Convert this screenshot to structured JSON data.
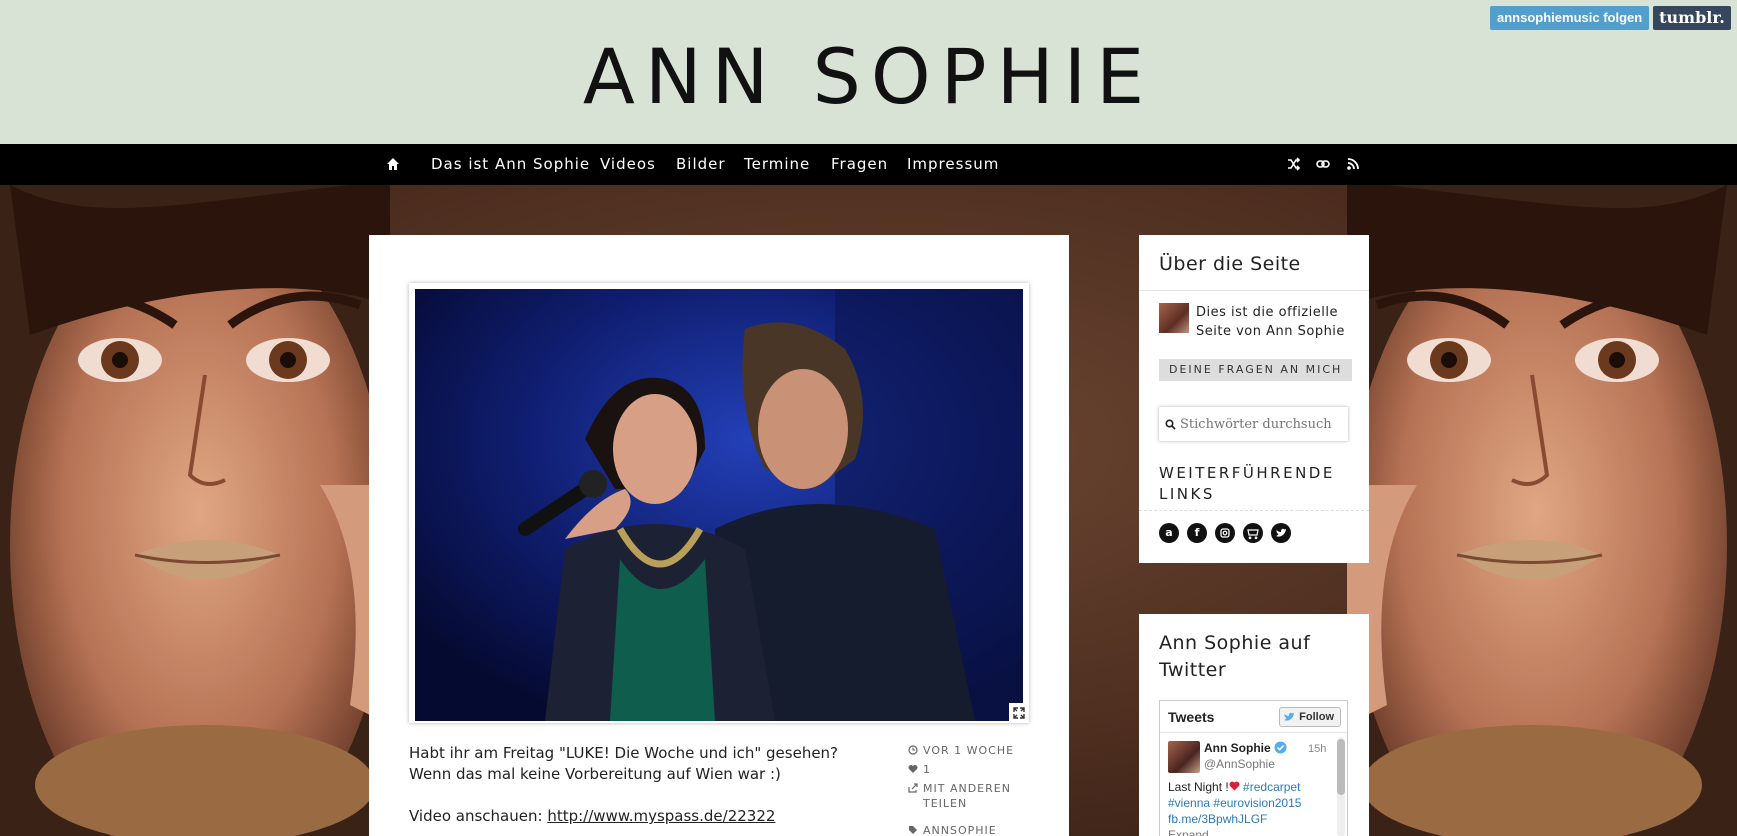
{
  "header": {
    "logo": "ANN SOPHIE",
    "tumblr_follow": "annsophiemusic folgen",
    "tumblr_logo": "tumblr."
  },
  "nav": {
    "items": [
      "Das ist Ann Sophie",
      "Videos",
      "Bilder",
      "Termine",
      "Fragen",
      "Impressum"
    ],
    "icons": [
      "home-icon",
      "shuffle-icon",
      "link-icon",
      "rss-icon"
    ]
  },
  "post": {
    "paragraph1": "Habt ihr am Freitag \"LUKE! Die Woche und ich\" gesehen? Wenn das mal keine Vorbereitung auf Wien war :)",
    "video_label": "Video anschauen: ",
    "video_link": "http://www.myspass.de/22322",
    "meta": {
      "time": "VOR 1 WOCHE",
      "likes": "1",
      "share": "MIT ANDEREN TEILEN",
      "tag": "ANNSOPHIE"
    }
  },
  "sidebar": {
    "about_title": "Über die Seite",
    "about_text": "Dies ist die offizielle Seite von Ann Sophie",
    "ask_button": "DEINE FRAGEN AN MICH",
    "search_placeholder": "Stichwörter durchsuch",
    "links_title": "WEITERFÜHRENDE LINKS",
    "social_icons": [
      "amazon-icon",
      "facebook-icon",
      "instagram-icon",
      "shop-icon",
      "twitter-icon"
    ],
    "twitter_title": "Ann Sophie auf Twitter"
  },
  "twitter_widget": {
    "title": "Tweets",
    "follow": "Follow",
    "tweet": {
      "name": "Ann Sophie",
      "handle": "@AnnSophie",
      "time": "15h",
      "text_start": "Last Night !",
      "tags": [
        "#redcarpet",
        "#vienna",
        "#eurovision2015"
      ],
      "link": "fb.me/3BpwhJLGF",
      "more": "Expand"
    }
  }
}
